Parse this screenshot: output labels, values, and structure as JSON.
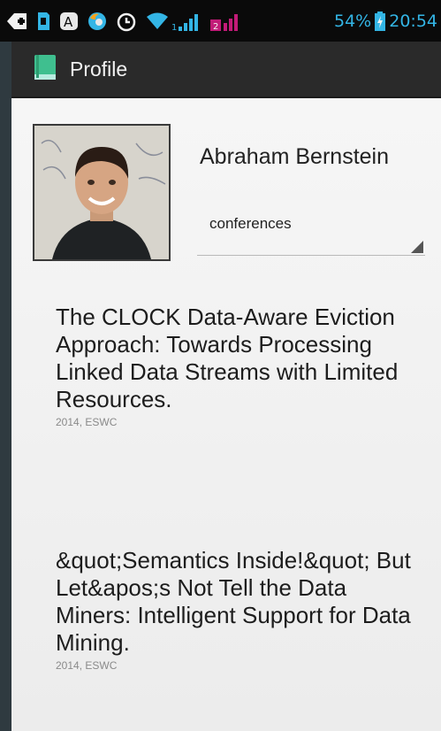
{
  "status_bar": {
    "battery_percent": "54%",
    "time": "20:54",
    "sim1_label": "1",
    "sim2_label": "2",
    "icons": [
      "add-icon",
      "sd-card-icon",
      "a-icon",
      "firefox-icon",
      "alarm-icon",
      "wifi-icon",
      "signal-icon",
      "battery-icon"
    ]
  },
  "action_bar": {
    "app_icon": "book-icon",
    "title": "Profile"
  },
  "profile": {
    "name": "Abraham Bernstein",
    "photo": "profile-photo",
    "filter": {
      "selected": "conferences"
    }
  },
  "publications": [
    {
      "title": "The CLOCK Data-Aware Eviction Approach: Towards Processing Linked Data Streams with Limited Resources.",
      "meta": "2014, ESWC"
    },
    {
      "title": "&quot;Semantics Inside!&quot; But Let&apos;s Not Tell the Data Miners: Intelligent Support for Data Mining.",
      "meta": "2014, ESWC"
    }
  ],
  "colors": {
    "status_text": "#33b5e5",
    "action_bar": "#2a2a2a",
    "app_icon": "#3fbf8f",
    "content_bg": "#f2f2f2"
  }
}
